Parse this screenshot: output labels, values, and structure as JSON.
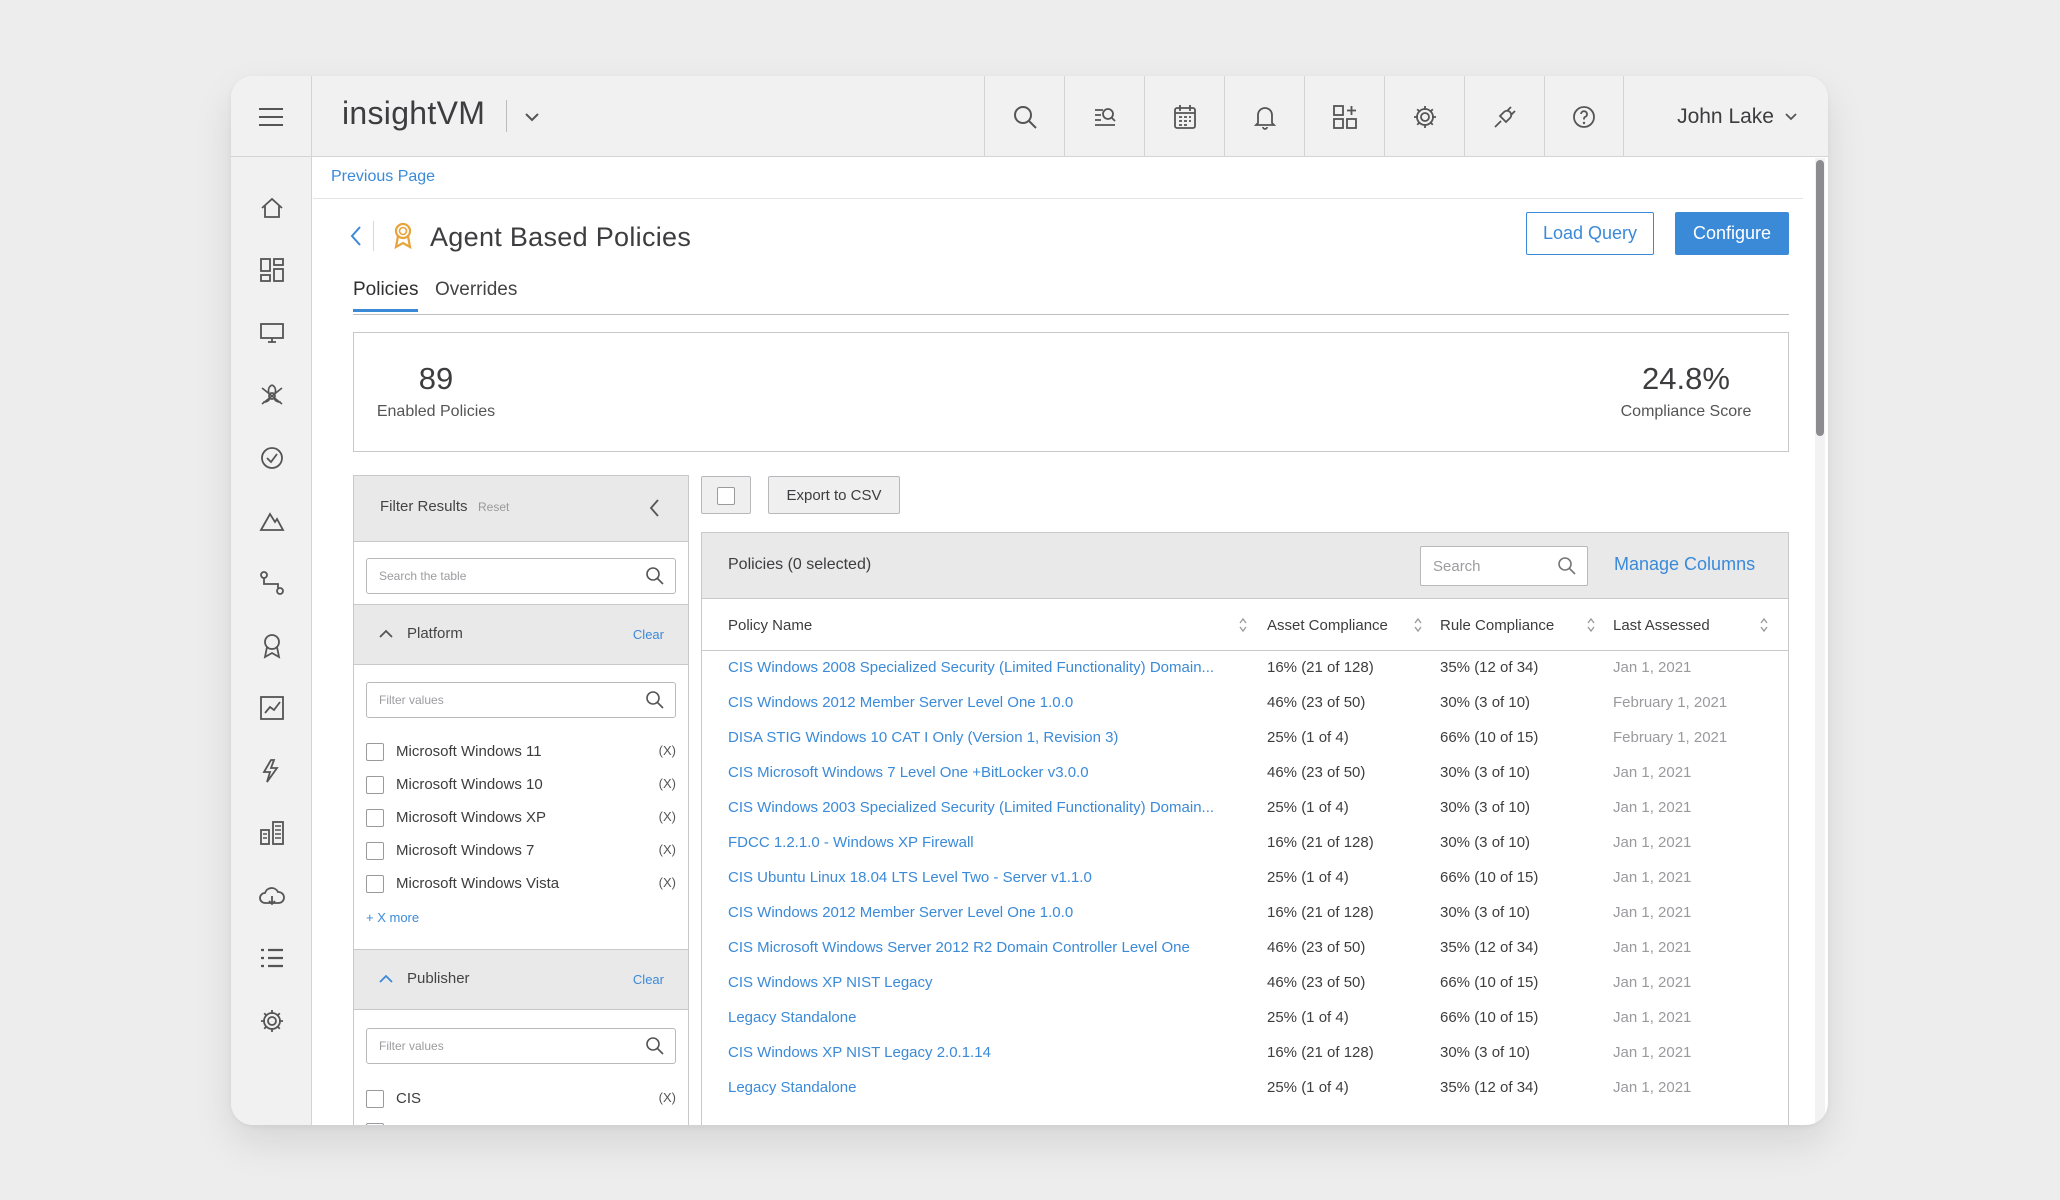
{
  "app": {
    "brand": "insightVM",
    "user_name": "John Lake",
    "accent_color": "#3b8ad8",
    "top_icons": [
      "search-icon",
      "scan-search-icon",
      "calendar-icon",
      "bell-icon",
      "add-widget-icon",
      "gear-icon",
      "plug-icon",
      "help-icon"
    ],
    "left_nav": [
      "home-icon",
      "dashboard-icon",
      "monitor-icon",
      "biohazard-icon",
      "check-circle-icon",
      "mountain-icon",
      "path-icon",
      "award-icon",
      "trend-chart-icon",
      "automation-icon",
      "modules-icon",
      "cloud-icon",
      "list-icon",
      "settings-icon"
    ]
  },
  "breadcrumb": {
    "previous_page": "Previous Page"
  },
  "header": {
    "title": "Agent Based Policies",
    "load_query": "Load Query",
    "configure": "Configure"
  },
  "tabs": [
    {
      "label": "Policies",
      "active": true
    },
    {
      "label": "Overrides",
      "active": false
    }
  ],
  "summary": {
    "enabled_policies": {
      "value": "89",
      "label": "Enabled Policies"
    },
    "compliance_score": {
      "value": "24.8%",
      "label": "Compliance Score"
    }
  },
  "filter": {
    "title": "Filter Results",
    "reset": "Reset",
    "search_placeholder": "Search the table",
    "platform": {
      "title": "Platform",
      "clear": "Clear",
      "placeholder": "Filter values",
      "options": [
        {
          "label": "Microsoft Windows 11",
          "count": "(X)"
        },
        {
          "label": "Microsoft Windows 10",
          "count": "(X)"
        },
        {
          "label": "Microsoft Windows XP",
          "count": "(X)"
        },
        {
          "label": "Microsoft Windows 7",
          "count": "(X)"
        },
        {
          "label": "Microsoft Windows Vista",
          "count": "(X)"
        }
      ],
      "more": "+ X more"
    },
    "publisher": {
      "title": "Publisher",
      "clear": "Clear",
      "placeholder": "Filter values",
      "options": [
        {
          "label": "CIS",
          "count": "(X)"
        }
      ]
    }
  },
  "toolbar": {
    "export": "Export to CSV"
  },
  "table": {
    "title": "Policies (0 selected)",
    "search_placeholder": "Search",
    "manage_columns": "Manage Columns",
    "columns": [
      "Policy Name",
      "Asset Compliance",
      "Rule Compliance",
      "Last Assessed"
    ],
    "rows": [
      [
        "CIS Windows 2008 Specialized Security (Limited Functionality) Domain...",
        "16% (21 of 128)",
        "35% (12 of 34)",
        "Jan 1, 2021"
      ],
      [
        "CIS Windows 2012 Member Server Level One 1.0.0",
        "46% (23 of 50)",
        "30% (3 of 10)",
        "February 1, 2021"
      ],
      [
        "DISA STIG Windows 10 CAT I Only (Version 1, Revision 3)",
        "25% (1 of 4)",
        "66% (10 of 15)",
        "February 1, 2021"
      ],
      [
        "CIS Microsoft Windows 7 Level One +BitLocker v3.0.0",
        "46% (23 of 50)",
        "30% (3 of 10)",
        "Jan 1, 2021"
      ],
      [
        "CIS Windows 2003 Specialized Security (Limited Functionality) Domain...",
        "25% (1 of 4)",
        "30% (3 of 10)",
        "Jan 1, 2021"
      ],
      [
        "FDCC 1.2.1.0 - Windows XP Firewall",
        "16% (21 of 128)",
        "30% (3 of 10)",
        "Jan 1, 2021"
      ],
      [
        "CIS Ubuntu Linux 18.04 LTS Level Two - Server v1.1.0",
        "25% (1 of 4)",
        "66% (10 of 15)",
        "Jan 1, 2021"
      ],
      [
        "CIS Windows 2012 Member Server Level One 1.0.0",
        "16% (21 of 128)",
        "30% (3 of 10)",
        "Jan 1, 2021"
      ],
      [
        "CIS Microsoft Windows Server 2012 R2 Domain Controller Level One",
        "46% (23 of 50)",
        "35% (12 of 34)",
        "Jan 1, 2021"
      ],
      [
        "CIS Windows XP NIST Legacy",
        "46% (23 of 50)",
        "66% (10 of 15)",
        "Jan 1, 2021"
      ],
      [
        "Legacy Standalone",
        "25% (1 of 4)",
        "66% (10 of 15)",
        "Jan 1, 2021"
      ],
      [
        "CIS Windows XP NIST Legacy 2.0.1.14",
        "16% (21 of 128)",
        "30% (3 of 10)",
        "Jan 1, 2021"
      ],
      [
        "Legacy Standalone",
        "25% (1 of 4)",
        "35% (12 of 34)",
        "Jan 1, 2021"
      ]
    ]
  }
}
